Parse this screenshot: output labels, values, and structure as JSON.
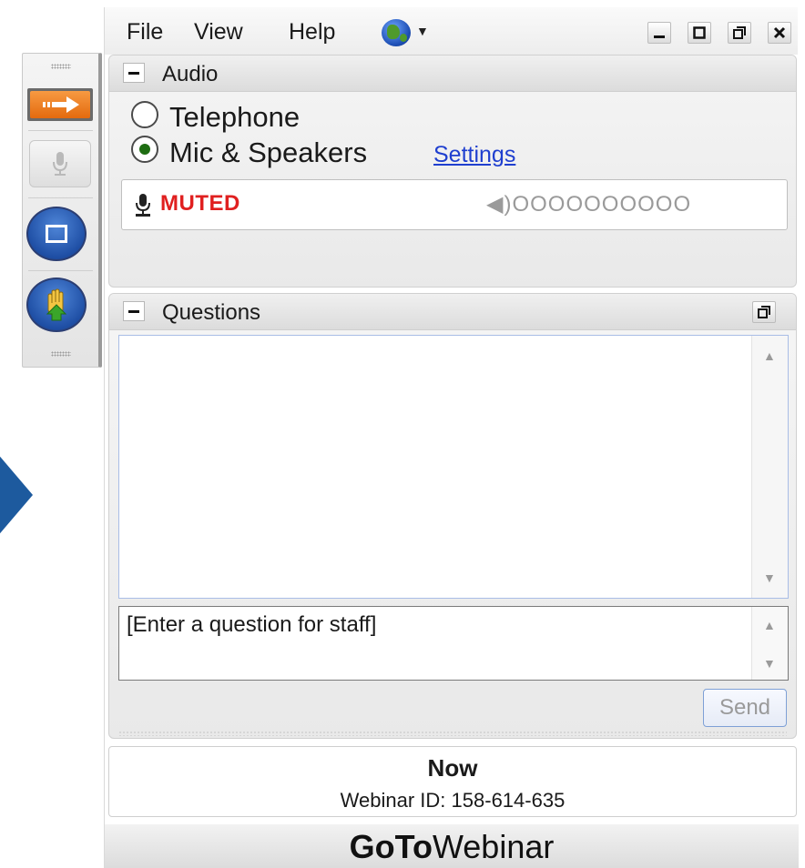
{
  "menu": {
    "file": "File",
    "view": "View",
    "help": "Help",
    "language_icon": "globe-icon",
    "window_buttons": [
      "minimize",
      "maximize",
      "restore",
      "close"
    ]
  },
  "toolbar": {
    "icons": [
      "orange-arrow-icon",
      "microphone-icon",
      "screen-icon",
      "raise-hand-icon"
    ]
  },
  "audio": {
    "title": "Audio",
    "options": [
      {
        "label": "Telephone",
        "selected": false
      },
      {
        "label": "Mic & Speakers",
        "selected": true
      }
    ],
    "settings_link": "Settings",
    "mute_status": "MUTED",
    "level_meter": "◀)OOOOOOOOOO"
  },
  "questions": {
    "title": "Questions",
    "input_text": "[Enter a question for staff]",
    "send_label": "Send"
  },
  "info": {
    "status": "Now",
    "webinar_id": "Webinar ID: 158-614-635"
  },
  "brand": {
    "part1": "GoTo",
    "part2": "Webinar"
  },
  "colors": {
    "muted": "#e02020",
    "link": "#1f3fcf",
    "selected_radio": "#1e6d12"
  }
}
